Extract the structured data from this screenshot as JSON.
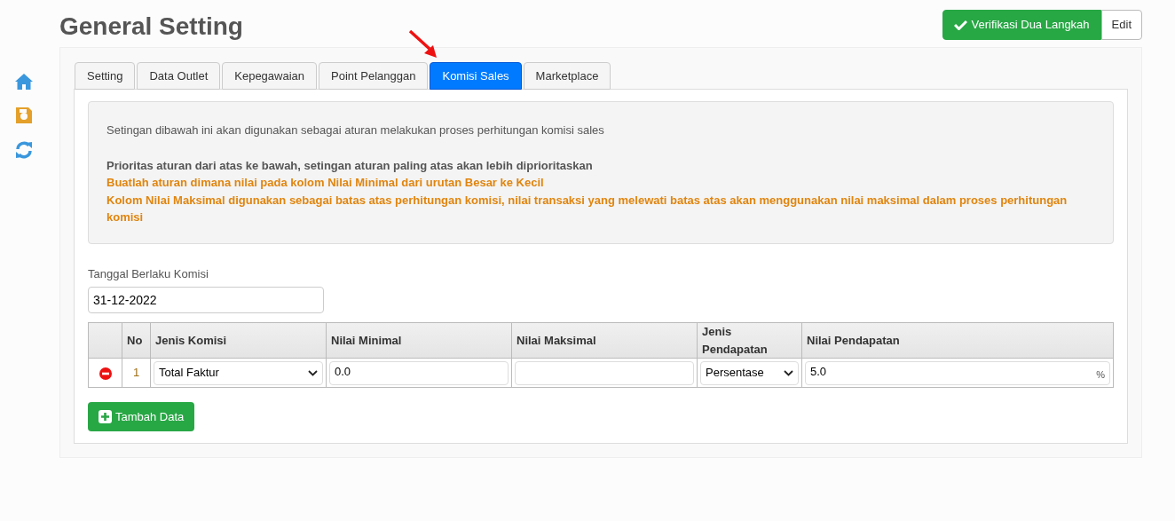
{
  "page_title": "General Setting",
  "header_buttons": [
    {
      "label": "Verifikasi Dua Langkah",
      "kind": "verify"
    },
    {
      "label": "Edit",
      "kind": "plain"
    }
  ],
  "tabs": [
    {
      "label": "Setting",
      "selected": false
    },
    {
      "label": "Data Outlet",
      "selected": false
    },
    {
      "label": "Kepegawaian",
      "selected": false
    },
    {
      "label": "Point Pelanggan",
      "selected": false
    },
    {
      "label": "Komisi Sales",
      "selected": true
    },
    {
      "label": "Marketplace",
      "selected": false
    }
  ],
  "info": {
    "intro": "Setingan dibawah ini akan digunakan sebagai aturan melakukan proses perhitungan komisi sales",
    "notes": [
      {
        "text": "Prioritas aturan dari atas ke bawah, setingan aturan paling atas akan lebih diprioritaskan",
        "kind": "priority"
      },
      {
        "text": "Buatlah aturan dimana nilai pada kolom Nilai Minimal dari urutan Besar ke Kecil",
        "kind": "warning"
      },
      {
        "text": "Kolom Nilai Maksimal digunakan sebagai batas atas perhitungan komisi, nilai transaksi yang melewati batas atas akan menggunakan nilai maksimal dalam proses perhitungan komisi",
        "kind": "warning"
      }
    ]
  },
  "date_field": {
    "label": "Tanggal Berlaku Komisi",
    "value": "31-12-2022"
  },
  "table": {
    "columns": [
      "No",
      "Jenis Komisi",
      "Nilai Minimal",
      "Nilai Maksimal",
      "Jenis Pendapatan",
      "Nilai Pendapatan"
    ],
    "rows": [
      {
        "no": "1",
        "jenis_komisi": "Total Faktur",
        "nilai_minimal": "0.0",
        "jenis_pendapatan": "Persentase",
        "nilai_pendapatan": "5.0",
        "unit": "%"
      }
    ]
  },
  "add_button": "Tambah Data"
}
